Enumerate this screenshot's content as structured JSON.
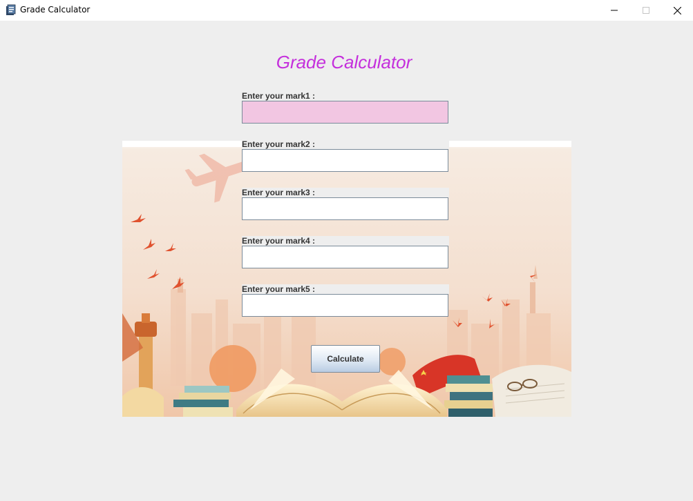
{
  "window": {
    "title": "Grade Calculator",
    "icon": "java-app-icon",
    "controls": [
      "minimize-icon",
      "maximize-icon",
      "close-icon"
    ]
  },
  "app": {
    "title": "Grade Calculator",
    "title_color": "#c42fdc"
  },
  "form": {
    "fields": [
      {
        "label": "Enter your mark1 :",
        "value": ""
      },
      {
        "label": "Enter your mark2 :",
        "value": ""
      },
      {
        "label": "Enter your mark3 :",
        "value": ""
      },
      {
        "label": "Enter your mark4 :",
        "value": ""
      },
      {
        "label": "Enter your mark5 :",
        "value": ""
      }
    ],
    "focused_field_color": "#f2c6e2",
    "calculate_label": "Calculate"
  },
  "background": {
    "image": "city-books-illustration"
  }
}
